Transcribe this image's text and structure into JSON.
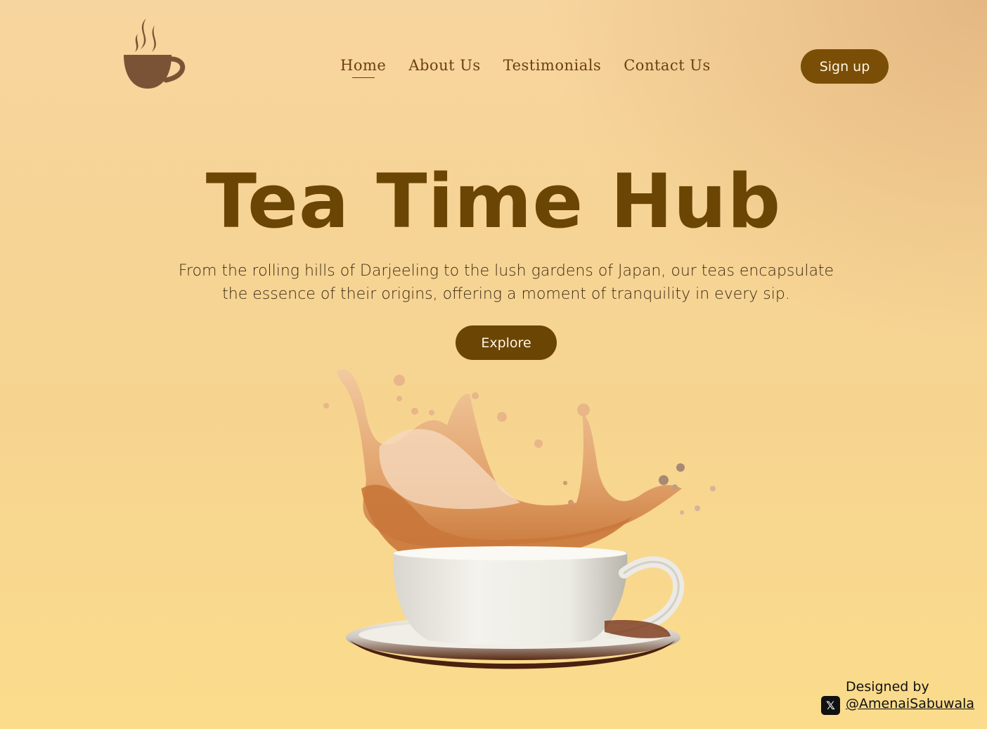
{
  "header": {
    "logo_icon": "steaming-cup-icon",
    "nav": [
      {
        "label": "Home",
        "active": true
      },
      {
        "label": "About Us",
        "active": false
      },
      {
        "label": "Testimonials",
        "active": false
      },
      {
        "label": "Contact Us",
        "active": false
      }
    ],
    "signup_label": "Sign up"
  },
  "hero": {
    "title": "Tea Time Hub",
    "subtitle_line1": "From the rolling hills of Darjeeling to the lush gardens of Japan, our teas encapsulate",
    "subtitle_line2": "the essence of their origins, offering a moment of tranquility in every sip.",
    "explore_label": "Explore",
    "image": "tea-cup-splash-image"
  },
  "credit": {
    "label": "Designed by",
    "icon": "x-logo-icon",
    "handle": "@AmenaiSabuwala"
  },
  "colors": {
    "brand_brown": "#7a4e06",
    "title_brown": "#6b4503",
    "nav_text": "#6b3f10",
    "background_light": "#f7d59e",
    "background_warm": "#d6a06c"
  }
}
